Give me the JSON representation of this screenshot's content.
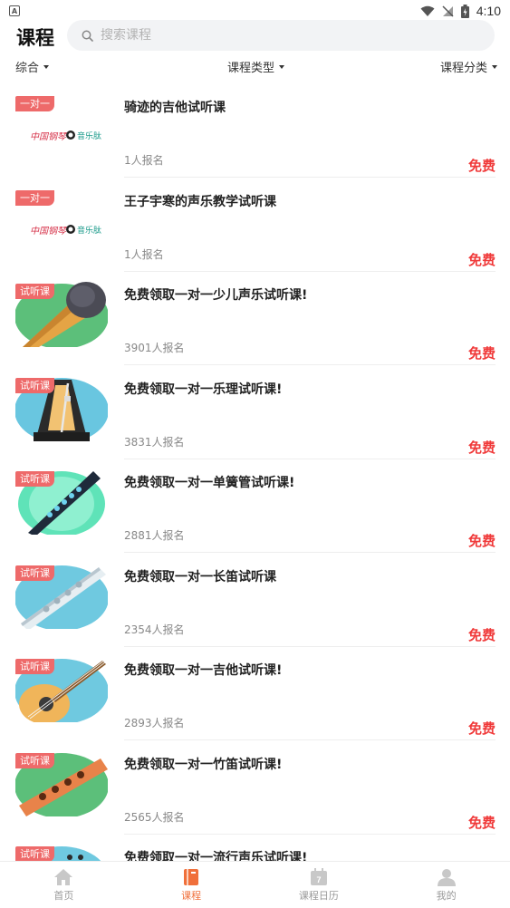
{
  "status": {
    "time": "4:10",
    "app_indicator": "A"
  },
  "header": {
    "title": "课程",
    "search_placeholder": "搜索课程"
  },
  "filters": {
    "sort": "综合",
    "type": "课程类型",
    "category": "课程分类"
  },
  "courses": [
    {
      "tag": "一对一",
      "title": "骑迹的吉他试听课",
      "count": "1人报名",
      "price": "免费",
      "image": "logo-banner"
    },
    {
      "tag": "一对一",
      "title": "王子宇寒的声乐教学试听课",
      "count": "1人报名",
      "price": "免费",
      "image": "logo-banner"
    },
    {
      "tag": "试听课",
      "title": "免费领取一对一少儿声乐试听课!",
      "count": "3901人报名",
      "price": "免费",
      "image": "microphone"
    },
    {
      "tag": "试听课",
      "title": "免费领取一对一乐理试听课!",
      "count": "3831人报名",
      "price": "免费",
      "image": "metronome"
    },
    {
      "tag": "试听课",
      "title": "免费领取一对一单簧管试听课!",
      "count": "2881人报名",
      "price": "免费",
      "image": "clarinet"
    },
    {
      "tag": "试听课",
      "title": "免费领取一对一长笛试听课",
      "count": "2354人报名",
      "price": "免费",
      "image": "flute"
    },
    {
      "tag": "试听课",
      "title": "免费领取一对一吉他试听课!",
      "count": "2893人报名",
      "price": "免费",
      "image": "guitar"
    },
    {
      "tag": "试听课",
      "title": "免费领取一对一竹笛试听课!",
      "count": "2565人报名",
      "price": "免费",
      "image": "bamboo-flute"
    },
    {
      "tag": "试听课",
      "title": "免费领取一对一流行声乐试听课!",
      "count": "",
      "price": "",
      "image": "pop-vocal"
    }
  ],
  "logo_text": {
    "left": "中国钢琴",
    "right": "音乐肽"
  },
  "calendar_day": "7",
  "tabs": [
    {
      "label": "首页",
      "icon": "home-icon"
    },
    {
      "label": "课程",
      "icon": "book-icon"
    },
    {
      "label": "课程日历",
      "icon": "calendar-icon"
    },
    {
      "label": "我的",
      "icon": "user-icon"
    }
  ],
  "colors": {
    "accent": "#f0703b",
    "price": "#f03a3a",
    "tag": "#ee6a6a"
  }
}
